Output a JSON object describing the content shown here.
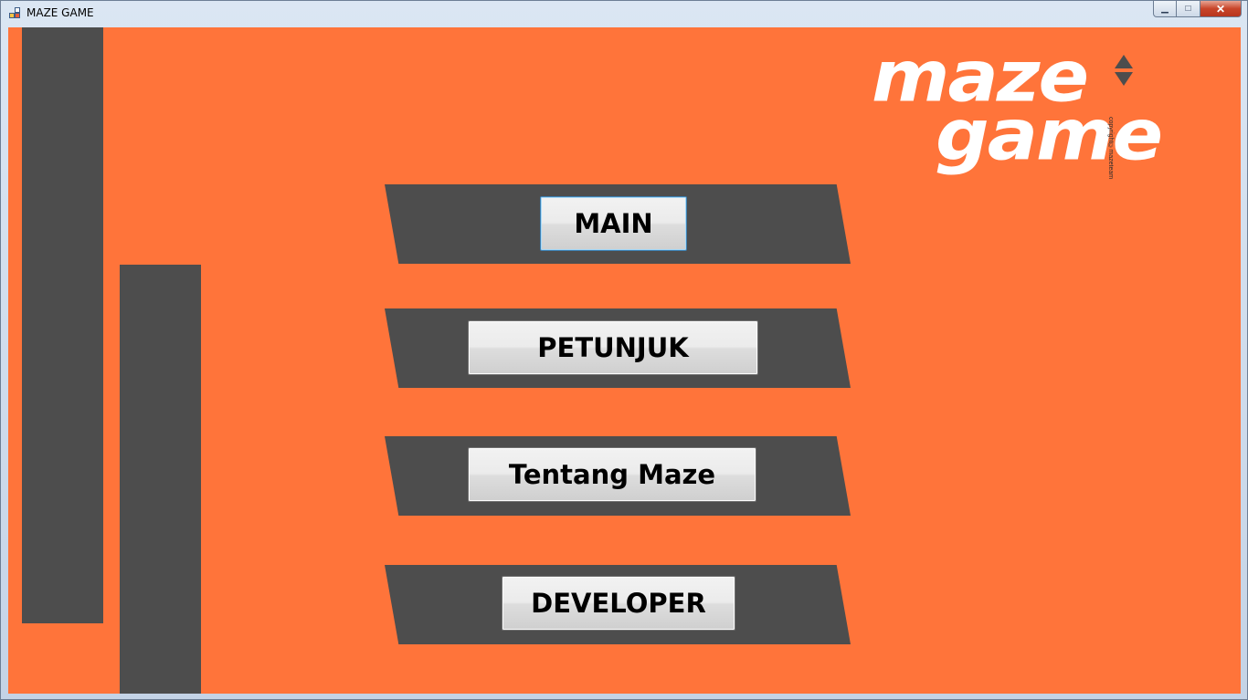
{
  "window": {
    "title": "MAZE GAME",
    "minimize_icon": "minimize-icon",
    "maximize_icon": "maximize-icon",
    "close_icon": "close-icon"
  },
  "colors": {
    "background": "#ff743a",
    "panel": "#4d4d4d",
    "logo": "#ffffff"
  },
  "logo": {
    "line1": "maze",
    "line2": "game",
    "copyright": "copyright©mazeteam",
    "icon": "up-down-arrows-icon"
  },
  "menu": {
    "items": [
      {
        "label": "MAIN",
        "focused": true
      },
      {
        "label": "PETUNJUK"
      },
      {
        "label": "Tentang Maze"
      },
      {
        "label": "DEVELOPER"
      }
    ]
  }
}
